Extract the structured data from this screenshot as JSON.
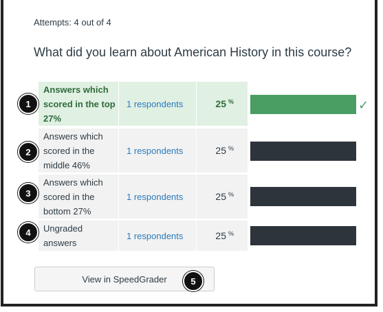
{
  "attempts": "Attempts: 4 out of 4",
  "question": "What did you learn about American History in this course?",
  "rows": [
    {
      "badge": "1",
      "label": "Answers which scored in the top 27%",
      "respondents": "1 respondents",
      "percent": "25",
      "percent_sign": "%",
      "bar_fill": 1.0,
      "correct": true
    },
    {
      "badge": "2",
      "label": "Answers which scored in the middle 46%",
      "respondents": "1 respondents",
      "percent": "25",
      "percent_sign": "%",
      "bar_fill": 1.0,
      "correct": false
    },
    {
      "badge": "3",
      "label": "Answers which scored in the bottom 27%",
      "respondents": "1 respondents",
      "percent": "25",
      "percent_sign": "%",
      "bar_fill": 1.0,
      "correct": false
    },
    {
      "badge": "4",
      "label": "Ungraded answers",
      "respondents": "1 respondents",
      "percent": "25",
      "percent_sign": "%",
      "bar_fill": 1.0,
      "correct": false
    }
  ],
  "check_icon": "✓",
  "speedgrader_button": "View in SpeedGrader",
  "button_badge": "5",
  "colors": {
    "correct_bar": "#4a9e63",
    "bar": "#2d343b",
    "link": "#2b7abc",
    "correct_bg": "#e0f0e3"
  }
}
